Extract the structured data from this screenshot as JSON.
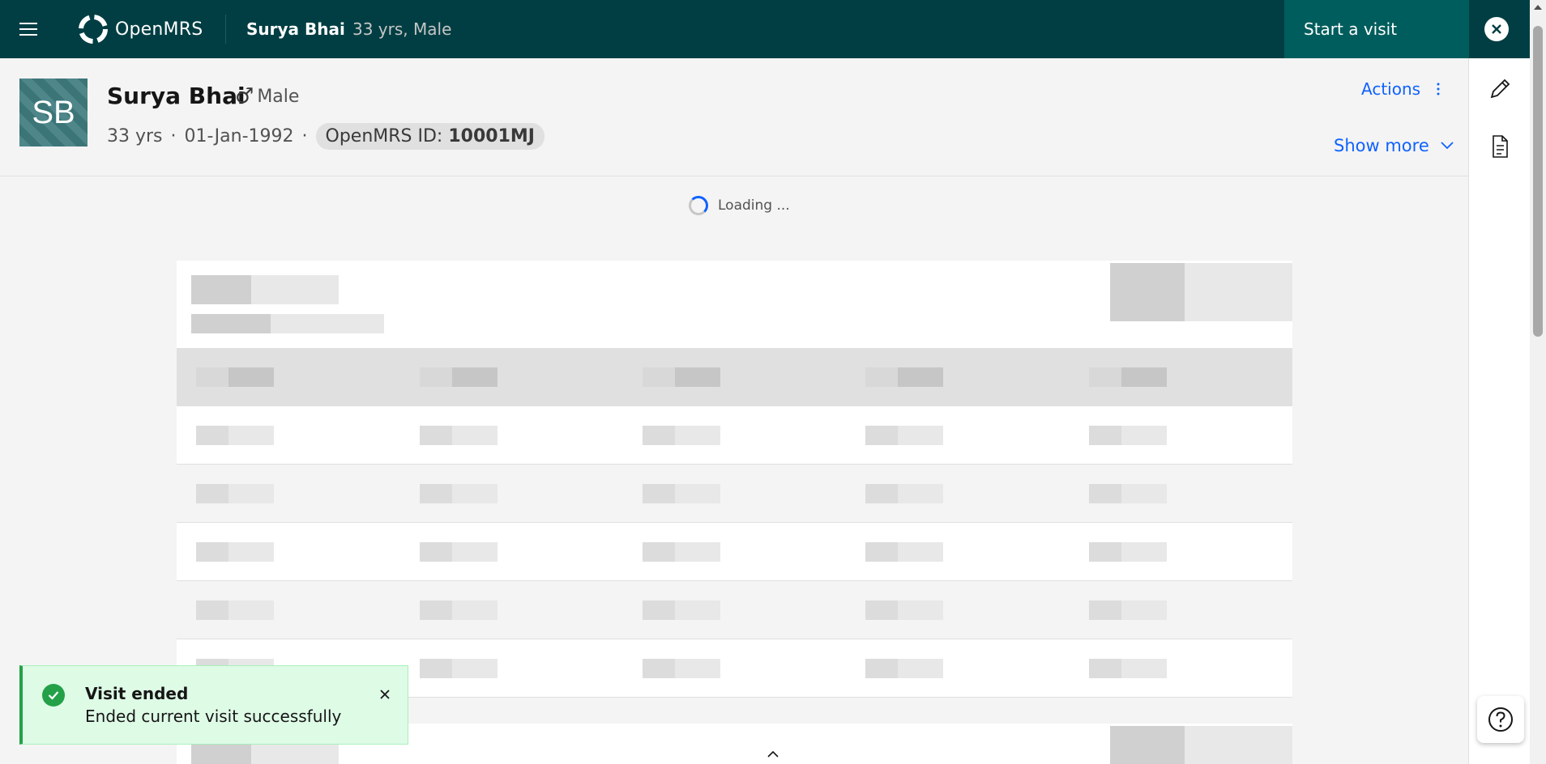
{
  "topbar": {
    "app_name": "OpenMRS",
    "patient_name": "Surya Bhai",
    "patient_info": "33 yrs, Male",
    "start_visit_label": "Start a visit"
  },
  "patient": {
    "initials": "SB",
    "name": "Surya Bhai",
    "gender_symbol": "♂",
    "gender": "Male",
    "age": "33 yrs",
    "dob": "01-Jan-1992",
    "id_label": "OpenMRS ID:",
    "id_value": "10001MJ",
    "separator": "·",
    "actions_label": "Actions",
    "show_more_label": "Show more"
  },
  "loading": {
    "text": "Loading ..."
  },
  "toast": {
    "title": "Visit ended",
    "subtitle": "Ended current visit successfully",
    "status_color": "#24a148"
  },
  "colors": {
    "topbar_bg": "#003e43",
    "start_visit_bg": "#005d5d",
    "link": "#0f62fe"
  },
  "icons": {
    "menu": "hamburger-icon",
    "logo": "openmrs-logo-icon",
    "close": "close-icon",
    "edit": "pencil-icon",
    "document": "document-icon",
    "help": "help-icon",
    "overflow": "overflow-menu-icon",
    "chevron": "chevron-down-icon",
    "success": "checkmark-icon"
  }
}
